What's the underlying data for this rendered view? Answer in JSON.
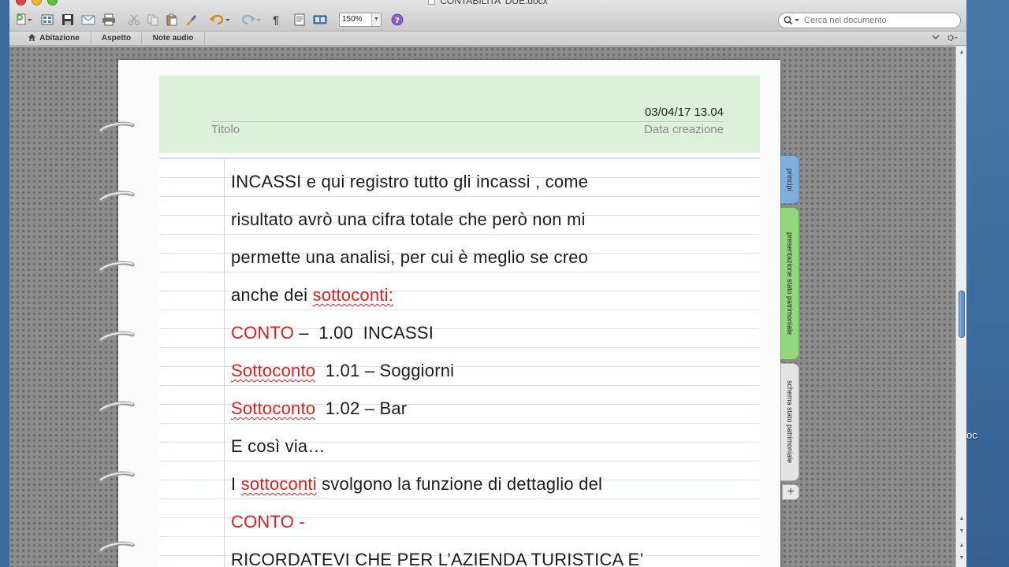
{
  "window": {
    "title": "CONTABILITA' DUE.docx"
  },
  "toolbar": {
    "zoom": "150%",
    "pilcrow": "¶",
    "search_placeholder": "Cerca nel documento"
  },
  "tabs": [
    {
      "label": "Abitazione"
    },
    {
      "label": "Aspetto"
    },
    {
      "label": "Note audio"
    }
  ],
  "header": {
    "date_value": "03/04/17 13.04",
    "title_label": "Titolo",
    "date_label": "Data creazione"
  },
  "document": {
    "l1": "INCASSI e qui registro tutto gli incassi , come",
    "l2": "risultato avrò una cifra totale che però non mi",
    "l3": "permette una analisi, per cui è meglio se creo",
    "l4a": "anche dei ",
    "l4b": "sottoconti:",
    "l5a": "CONTO",
    "l5b": " –  1.00  INCASSI",
    "l6a": "Sottoconto",
    "l6b": "  1.01 – Soggiorni",
    "l7a": "Sottoconto",
    "l7b": "  1.02 – Bar",
    "l8": "E così via…",
    "l9a": "I ",
    "l9b": "sottoconti",
    "l9c": " svolgono la funzione di dettaglio del",
    "l10": "CONTO -",
    "l11": "RICORDATEVI CHE PER L’AZIENDA TURISTICA E’"
  },
  "side_tabs": [
    {
      "label": "principi",
      "color": "#7fb0dd"
    },
    {
      "label": "presentazione stato patrimoniale",
      "color": "#92d67e"
    },
    {
      "label": "schema stato patrimoniale",
      "color": "#e4e4e4"
    }
  ],
  "side_add": "+",
  "desktop": {
    "partial_label": "oc"
  },
  "colors": {
    "header_bg": "#dcf2d8",
    "red_text": "#e01e1e",
    "scroll_thumb": "#4f87c9"
  }
}
